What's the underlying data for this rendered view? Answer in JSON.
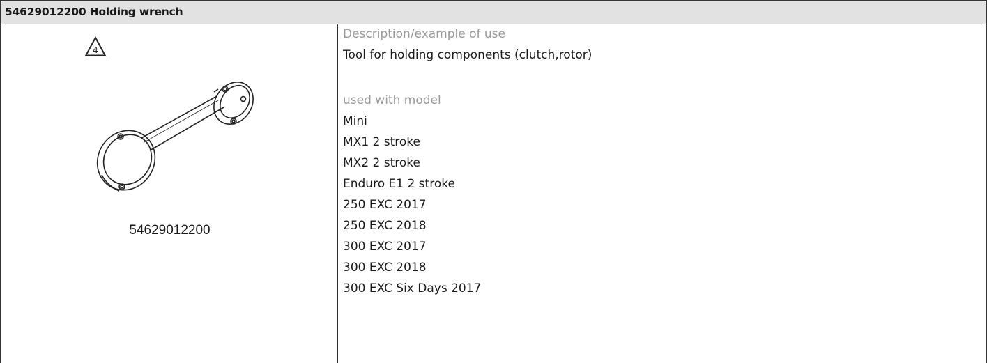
{
  "header": {
    "title": "54629012200 Holding wrench"
  },
  "figure": {
    "warning_mark": "4",
    "part_number": "54629012200",
    "icons": [
      "warning-triangle-icon",
      "holding-wrench-illustration"
    ]
  },
  "details": {
    "description_label": "Description/example of use",
    "description_text": "Tool for holding components (clutch,rotor)",
    "models_label": "used with model",
    "models": [
      "Mini",
      "MX1 2 stroke",
      "MX2 2 stroke",
      "Enduro E1 2 stroke",
      "250 EXC 2017",
      "250 EXC 2018",
      "300 EXC 2017",
      "300 EXC 2018",
      "300 EXC Six Days 2017"
    ]
  }
}
